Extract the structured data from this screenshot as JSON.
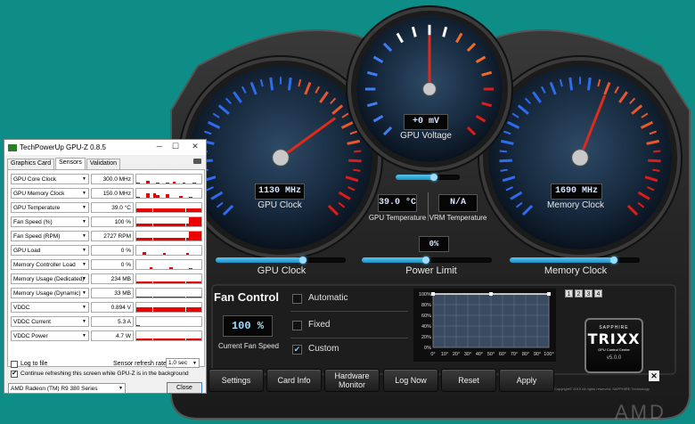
{
  "trixx": {
    "gauges": {
      "gpu_clock": {
        "value": "1130 MHz",
        "label": "GPU Clock",
        "level": 0.7
      },
      "gpu_voltage": {
        "value": "+0 mV",
        "label": "GPU Voltage",
        "level": 0.5
      },
      "memory_clock": {
        "value": "1690 MHz",
        "label": "Memory Clock",
        "level": 0.58
      },
      "gpu_temperature": {
        "value": "39.0 °C",
        "label": "GPU Temperature"
      },
      "vrm_temperature": {
        "value": "N/A",
        "label": "VRM Temperature"
      }
    },
    "sliders": {
      "gpu_clock": {
        "label": "GPU Clock",
        "level": 0.67
      },
      "power_limit": {
        "label": "Power Limit",
        "value": "0%",
        "level": 0.49
      },
      "memory_clock": {
        "label": "Memory Clock",
        "level": 0.8
      },
      "voltage_top": {
        "level": 0.6
      }
    },
    "fan_control": {
      "title": "Fan Control",
      "current_speed": "100 %",
      "current_speed_label": "Current Fan Speed",
      "modes": [
        "Automatic",
        "Fixed",
        "Custom"
      ],
      "selected_mode": "Custom",
      "curve_y_labels": [
        "100%",
        "80%",
        "60%",
        "40%",
        "20%",
        "0%"
      ],
      "curve_x_labels": [
        "0°",
        "10°",
        "20°",
        "30°",
        "40°",
        "50°",
        "60°",
        "70°",
        "80°",
        "90°",
        "100°"
      ],
      "curve_points": [
        {
          "temp": 0,
          "speed": 100
        },
        {
          "temp": 50,
          "speed": 100
        },
        {
          "temp": 100,
          "speed": 100
        }
      ]
    },
    "profiles": [
      "1",
      "2",
      "3",
      "4"
    ],
    "logo": {
      "brand": "SAPPHIRE",
      "name": "TRIXX",
      "subtitle": "GPU Control Center",
      "version": "v5.0.0"
    },
    "copyright": "Copyright© 2015 All rights reserved, SAPPHIRE Technology",
    "buttons": [
      "Settings",
      "Card Info",
      "Hardware Monitor",
      "Log Now",
      "Reset",
      "Apply"
    ],
    "watermark": "AMD"
  },
  "gpuz": {
    "title": "TechPowerUp GPU-Z 0.8.5",
    "tabs": [
      "Graphics Card",
      "Sensors",
      "Validation"
    ],
    "active_tab": "Sensors",
    "sensors": [
      {
        "name": "GPU Core Clock",
        "value": "300.0 MHz",
        "graph": [
          0.1,
          0,
          0,
          0.3,
          0,
          0,
          0.1,
          0,
          0,
          0.1,
          0,
          0.2,
          0,
          0,
          0.1,
          0,
          0,
          0.1,
          0,
          0
        ]
      },
      {
        "name": "GPU Memory Clock",
        "value": "150.0 MHz",
        "graph": [
          0.1,
          0,
          0,
          0.5,
          0,
          0.5,
          0.3,
          0,
          0,
          0.4,
          0,
          0,
          0,
          0.2,
          0,
          0,
          0.1,
          0,
          0,
          0
        ]
      },
      {
        "name": "GPU Temperature",
        "value": "39.0 °C",
        "graph": [
          0.4,
          0.4,
          0.4,
          0.4,
          0.4,
          0.4,
          0.4,
          0.4,
          0.4,
          0.4,
          0.4,
          0.4,
          0.4,
          0.4,
          0.4,
          0.4,
          0.4,
          0.4,
          0.4,
          0.4
        ]
      },
      {
        "name": "Fan Speed (%)",
        "value": "100 %",
        "graph": [
          0.3,
          0.3,
          0.3,
          0.3,
          0.3,
          0.3,
          0.3,
          0.3,
          0.3,
          0.3,
          0.3,
          0.3,
          0.3,
          0.3,
          0.3,
          0.3,
          1,
          1,
          1,
          1
        ]
      },
      {
        "name": "Fan Speed (RPM)",
        "value": "2727 RPM",
        "graph": [
          0.3,
          0.3,
          0.3,
          0.3,
          0.3,
          0.3,
          0.3,
          0.3,
          0.3,
          0.3,
          0.3,
          0.3,
          0.3,
          0.3,
          0.3,
          0.3,
          0.9,
          0.9,
          0.9,
          0.9
        ]
      },
      {
        "name": "GPU Load",
        "value": "0 %",
        "graph": [
          0,
          0,
          0.3,
          0,
          0,
          0,
          0,
          0,
          0.2,
          0,
          0,
          0,
          0,
          0,
          0,
          0.2,
          0,
          0,
          0,
          0
        ]
      },
      {
        "name": "Memory Controller Load",
        "value": "0 %",
        "graph": [
          0,
          0,
          0,
          0,
          0.2,
          0,
          0,
          0,
          0,
          0,
          0.2,
          0,
          0,
          0,
          0,
          0,
          0.1,
          0,
          0,
          0
        ]
      },
      {
        "name": "Memory Usage (Dedicated)",
        "value": "234 MB",
        "graph": [
          0.15,
          0.15,
          0.15,
          0.15,
          0.15,
          0.15,
          0.15,
          0.15,
          0.15,
          0.15,
          0.15,
          0.15,
          0.15,
          0.15,
          0.15,
          0.15,
          0.15,
          0.15,
          0.15,
          0.15
        ]
      },
      {
        "name": "Memory Usage (Dynamic)",
        "value": "33 MB",
        "graph": [
          0.1,
          0.1,
          0.1,
          0.1,
          0.1,
          0.1,
          0.1,
          0.1,
          0.1,
          0.1,
          0.1,
          0.1,
          0.1,
          0.1,
          0.1,
          0.1,
          0.1,
          0.1,
          0.1,
          0.1
        ]
      },
      {
        "name": "VDDC",
        "value": "0.894 V",
        "graph": [
          0.5,
          0.5,
          0.5,
          0.5,
          0.5,
          0.5,
          0.5,
          0.5,
          0.5,
          0.5,
          0.5,
          0.5,
          0.5,
          0.5,
          0.5,
          0.5,
          0.5,
          0.5,
          0.5,
          0.5
        ]
      },
      {
        "name": "VDDC Current",
        "value": "5.3 A",
        "graph": [
          0.1,
          0,
          0,
          0,
          0,
          0,
          0,
          0,
          0,
          0,
          0,
          0,
          0,
          0,
          0,
          0,
          0,
          0,
          0,
          0
        ]
      },
      {
        "name": "VDDC Power",
        "value": "4.7 W",
        "graph": [
          0.2,
          0.2,
          0.2,
          0.2,
          0.2,
          0.2,
          0.2,
          0.2,
          0.2,
          0.2,
          0.2,
          0.2,
          0.2,
          0.2,
          0.2,
          0.2,
          0.2,
          0.2,
          0.2,
          0.2
        ]
      }
    ],
    "log_to_file": "Log to file",
    "refresh_label": "Sensor refresh rate:",
    "refresh_value": "1.0 sec",
    "continue_refresh": "Continue refreshing this screen while GPU-Z is in the background",
    "card_select": "AMD Radeon (TM) R9 380 Series",
    "close_button": "Close"
  }
}
